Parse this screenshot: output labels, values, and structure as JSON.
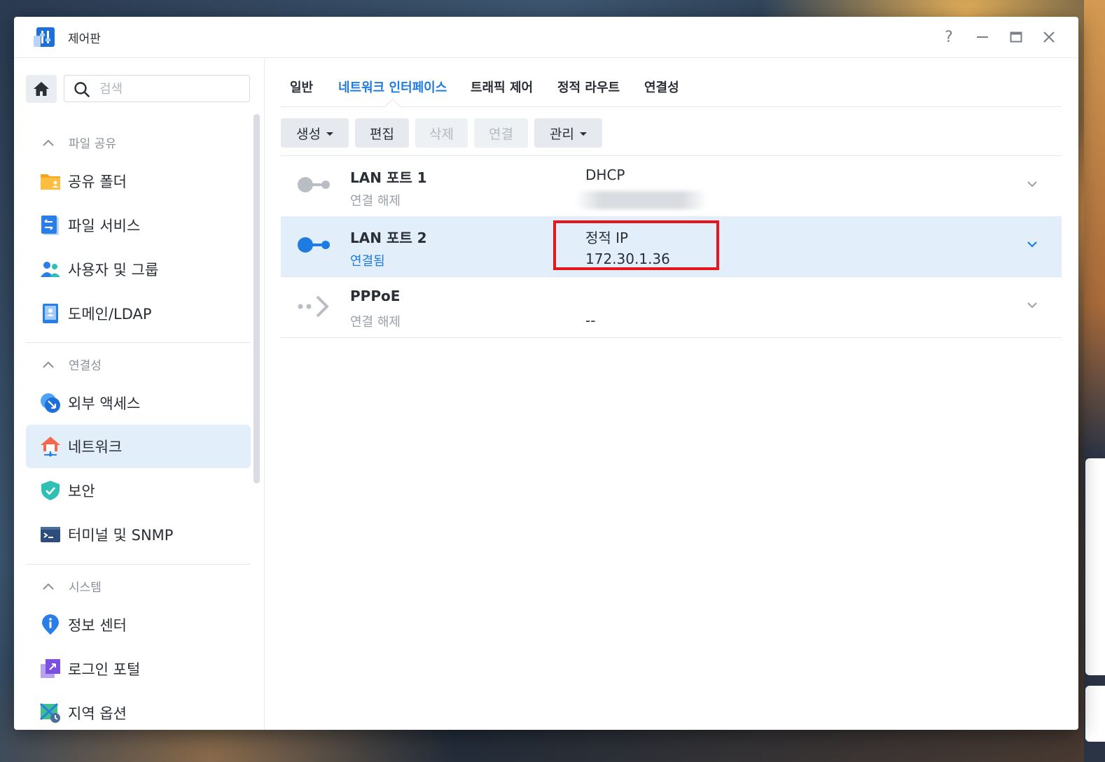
{
  "window": {
    "title": "제어판",
    "controls": [
      "?",
      "—",
      "□",
      "✕"
    ]
  },
  "sidebar": {
    "search_placeholder": "검색",
    "sections": [
      {
        "title": "파일 공유",
        "items": [
          {
            "label": "공유 폴더",
            "icon": "shared-folder-icon"
          },
          {
            "label": "파일 서비스",
            "icon": "file-services-icon"
          },
          {
            "label": "사용자 및 그룹",
            "icon": "users-groups-icon"
          },
          {
            "label": "도메인/LDAP",
            "icon": "domain-ldap-icon"
          }
        ]
      },
      {
        "title": "연결성",
        "items": [
          {
            "label": "외부 액세스",
            "icon": "external-access-icon"
          },
          {
            "label": "네트워크",
            "icon": "network-icon",
            "active": true
          },
          {
            "label": "보안",
            "icon": "security-shield-icon"
          },
          {
            "label": "터미널 및 SNMP",
            "icon": "terminal-icon"
          }
        ]
      },
      {
        "title": "시스템",
        "items": [
          {
            "label": "정보 센터",
            "icon": "info-center-icon"
          },
          {
            "label": "로그인 포털",
            "icon": "login-portal-icon"
          },
          {
            "label": "지역 옵션",
            "icon": "regional-options-icon"
          }
        ]
      }
    ]
  },
  "tabs": [
    {
      "label": "일반"
    },
    {
      "label": "네트워크 인터페이스",
      "active": true
    },
    {
      "label": "트래픽 제어"
    },
    {
      "label": "정적 라우트"
    },
    {
      "label": "연결성"
    }
  ],
  "toolbar": {
    "create": "생성",
    "edit": "편집",
    "delete": "삭제",
    "connect": "연결",
    "manage": "관리"
  },
  "interfaces": [
    {
      "name": "LAN 포트 1",
      "status": "연결 해제",
      "mode": "DHCP",
      "ip": "",
      "connected": false
    },
    {
      "name": "LAN 포트 2",
      "status": "연결됨",
      "mode": "정적 IP",
      "ip": "172.30.1.36",
      "connected": true,
      "selected": true
    },
    {
      "name": "PPPoE",
      "status": "연결 해제",
      "mode": "",
      "ip": "--",
      "connected": false
    }
  ],
  "colors": {
    "accent": "#1e7be0",
    "selected_row": "#e3eefb",
    "highlight": "#e8151b"
  }
}
